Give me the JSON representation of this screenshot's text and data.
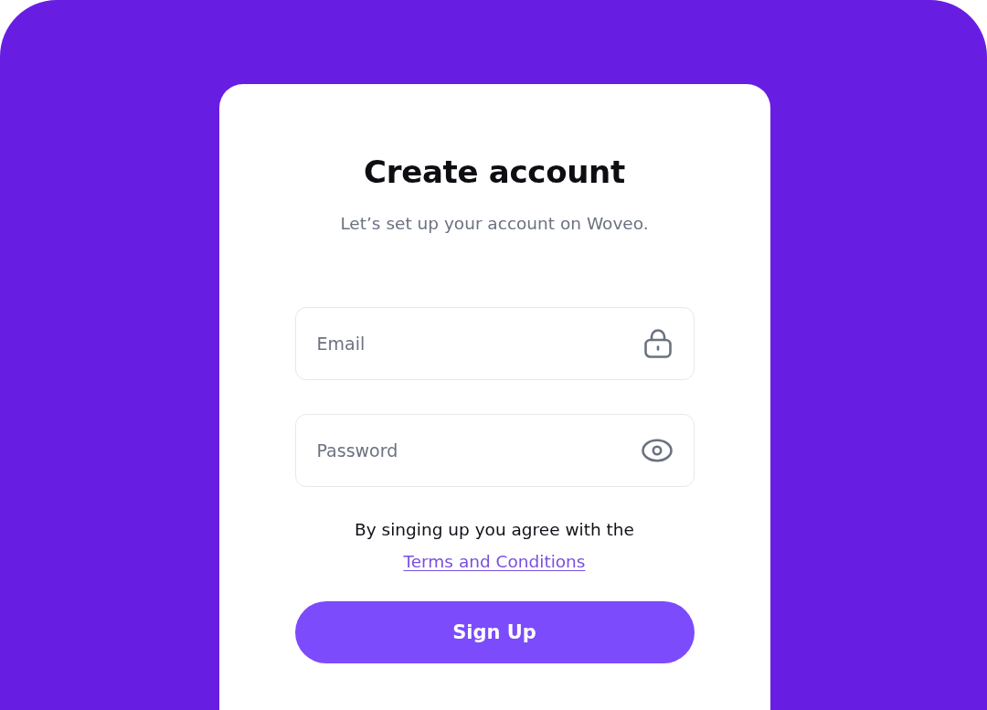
{
  "card": {
    "title": "Create account",
    "subtitle": "Let’s set up your account on Woveo."
  },
  "fields": [
    {
      "kind": "email",
      "placeholder": "Email"
    },
    {
      "kind": "password",
      "placeholder": "Password"
    }
  ],
  "agreement": {
    "text": "By singing up you agree with the",
    "link": "Terms and Conditions"
  },
  "submit_button": {
    "label": "Sign Up"
  }
}
